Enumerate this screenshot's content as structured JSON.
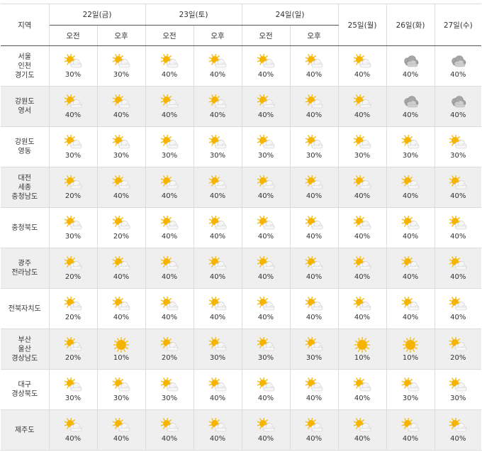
{
  "header": {
    "region_label": "지역",
    "days": [
      "22일(금)",
      "23일(토)",
      "24일(일)"
    ],
    "single_days": [
      "25일(월)",
      "26일(화)",
      "27일(수)"
    ],
    "am": "오전",
    "pm": "오후"
  },
  "rows": [
    {
      "name": [
        "서울",
        "인천",
        "경기도"
      ],
      "cells": [
        {
          "icon": "partly-cloudy",
          "pct": "30%"
        },
        {
          "icon": "partly-cloudy",
          "pct": "30%"
        },
        {
          "icon": "partly-cloudy",
          "pct": "40%"
        },
        {
          "icon": "partly-cloudy",
          "pct": "40%"
        },
        {
          "icon": "partly-cloudy",
          "pct": "40%"
        },
        {
          "icon": "partly-cloudy",
          "pct": "40%"
        },
        {
          "icon": "partly-cloudy",
          "pct": "40%"
        },
        {
          "icon": "cloudy",
          "pct": "40%"
        },
        {
          "icon": "cloudy",
          "pct": "40%"
        }
      ]
    },
    {
      "name": [
        "강원도",
        "영서"
      ],
      "cells": [
        {
          "icon": "partly-cloudy",
          "pct": "40%"
        },
        {
          "icon": "partly-cloudy",
          "pct": "40%"
        },
        {
          "icon": "partly-cloudy",
          "pct": "40%"
        },
        {
          "icon": "partly-cloudy",
          "pct": "40%"
        },
        {
          "icon": "partly-cloudy",
          "pct": "40%"
        },
        {
          "icon": "partly-cloudy",
          "pct": "40%"
        },
        {
          "icon": "partly-cloudy",
          "pct": "40%"
        },
        {
          "icon": "cloudy",
          "pct": "40%"
        },
        {
          "icon": "cloudy",
          "pct": "40%"
        }
      ]
    },
    {
      "name": [
        "강원도",
        "영동"
      ],
      "cells": [
        {
          "icon": "partly-cloudy",
          "pct": "30%"
        },
        {
          "icon": "partly-cloudy",
          "pct": "30%"
        },
        {
          "icon": "partly-cloudy",
          "pct": "30%"
        },
        {
          "icon": "partly-cloudy",
          "pct": "30%"
        },
        {
          "icon": "partly-cloudy",
          "pct": "30%"
        },
        {
          "icon": "partly-cloudy",
          "pct": "30%"
        },
        {
          "icon": "partly-cloudy",
          "pct": "30%"
        },
        {
          "icon": "partly-cloudy",
          "pct": "30%"
        },
        {
          "icon": "partly-cloudy",
          "pct": "30%"
        }
      ]
    },
    {
      "name": [
        "대전",
        "세종",
        "충청남도"
      ],
      "cells": [
        {
          "icon": "partly-cloudy",
          "pct": "20%"
        },
        {
          "icon": "partly-cloudy",
          "pct": "40%"
        },
        {
          "icon": "partly-cloudy",
          "pct": "40%"
        },
        {
          "icon": "partly-cloudy",
          "pct": "40%"
        },
        {
          "icon": "partly-cloudy",
          "pct": "40%"
        },
        {
          "icon": "partly-cloudy",
          "pct": "40%"
        },
        {
          "icon": "partly-cloudy",
          "pct": "40%"
        },
        {
          "icon": "partly-cloudy",
          "pct": "40%"
        },
        {
          "icon": "partly-cloudy",
          "pct": "40%"
        }
      ]
    },
    {
      "name": [
        "충청북도"
      ],
      "cells": [
        {
          "icon": "partly-cloudy",
          "pct": "30%"
        },
        {
          "icon": "partly-cloudy",
          "pct": "20%"
        },
        {
          "icon": "partly-cloudy",
          "pct": "40%"
        },
        {
          "icon": "partly-cloudy",
          "pct": "40%"
        },
        {
          "icon": "partly-cloudy",
          "pct": "40%"
        },
        {
          "icon": "partly-cloudy",
          "pct": "40%"
        },
        {
          "icon": "partly-cloudy",
          "pct": "40%"
        },
        {
          "icon": "partly-cloudy",
          "pct": "40%"
        },
        {
          "icon": "partly-cloudy",
          "pct": "40%"
        }
      ]
    },
    {
      "name": [
        "광주",
        "전라남도"
      ],
      "cells": [
        {
          "icon": "partly-cloudy",
          "pct": "20%"
        },
        {
          "icon": "partly-cloudy",
          "pct": "40%"
        },
        {
          "icon": "partly-cloudy",
          "pct": "40%"
        },
        {
          "icon": "partly-cloudy",
          "pct": "40%"
        },
        {
          "icon": "partly-cloudy",
          "pct": "40%"
        },
        {
          "icon": "partly-cloudy",
          "pct": "40%"
        },
        {
          "icon": "partly-cloudy",
          "pct": "40%"
        },
        {
          "icon": "partly-cloudy",
          "pct": "40%"
        },
        {
          "icon": "partly-cloudy",
          "pct": "40%"
        }
      ]
    },
    {
      "name": [
        "전북자치도"
      ],
      "cells": [
        {
          "icon": "partly-cloudy",
          "pct": "20%"
        },
        {
          "icon": "partly-cloudy",
          "pct": "40%"
        },
        {
          "icon": "partly-cloudy",
          "pct": "40%"
        },
        {
          "icon": "partly-cloudy",
          "pct": "40%"
        },
        {
          "icon": "partly-cloudy",
          "pct": "40%"
        },
        {
          "icon": "partly-cloudy",
          "pct": "40%"
        },
        {
          "icon": "partly-cloudy",
          "pct": "40%"
        },
        {
          "icon": "partly-cloudy",
          "pct": "40%"
        },
        {
          "icon": "partly-cloudy",
          "pct": "40%"
        }
      ]
    },
    {
      "name": [
        "부산",
        "울산",
        "경상남도"
      ],
      "cells": [
        {
          "icon": "partly-cloudy",
          "pct": "20%"
        },
        {
          "icon": "sunny",
          "pct": "10%"
        },
        {
          "icon": "partly-cloudy",
          "pct": "20%"
        },
        {
          "icon": "partly-cloudy",
          "pct": "30%"
        },
        {
          "icon": "partly-cloudy",
          "pct": "30%"
        },
        {
          "icon": "partly-cloudy",
          "pct": "30%"
        },
        {
          "icon": "sunny",
          "pct": "10%"
        },
        {
          "icon": "sunny",
          "pct": "10%"
        },
        {
          "icon": "partly-cloudy",
          "pct": "20%"
        }
      ]
    },
    {
      "name": [
        "대구",
        "경상북도"
      ],
      "cells": [
        {
          "icon": "partly-cloudy",
          "pct": "30%"
        },
        {
          "icon": "partly-cloudy",
          "pct": "30%"
        },
        {
          "icon": "partly-cloudy",
          "pct": "30%"
        },
        {
          "icon": "partly-cloudy",
          "pct": "40%"
        },
        {
          "icon": "partly-cloudy",
          "pct": "40%"
        },
        {
          "icon": "partly-cloudy",
          "pct": "40%"
        },
        {
          "icon": "partly-cloudy",
          "pct": "40%"
        },
        {
          "icon": "partly-cloudy",
          "pct": "30%"
        },
        {
          "icon": "partly-cloudy",
          "pct": "30%"
        }
      ]
    },
    {
      "name": [
        "제주도"
      ],
      "cells": [
        {
          "icon": "partly-cloudy",
          "pct": "40%"
        },
        {
          "icon": "partly-cloudy",
          "pct": "40%"
        },
        {
          "icon": "partly-cloudy",
          "pct": "40%"
        },
        {
          "icon": "partly-cloudy",
          "pct": "40%"
        },
        {
          "icon": "partly-cloudy",
          "pct": "40%"
        },
        {
          "icon": "partly-cloudy",
          "pct": "40%"
        },
        {
          "icon": "partly-cloudy",
          "pct": "40%"
        },
        {
          "icon": "partly-cloudy",
          "pct": "40%"
        },
        {
          "icon": "partly-cloudy",
          "pct": "40%"
        }
      ]
    }
  ],
  "colors": {
    "sun": "#f5b400",
    "sun_ray": "#f7c02a",
    "cloud": "#f6f6f6",
    "cloud_stroke": "#cfcfcf",
    "dark_cloud": "#a6a6a6",
    "dark_cloud_stroke": "#8c8c8c",
    "shade_row": "#efefef"
  }
}
